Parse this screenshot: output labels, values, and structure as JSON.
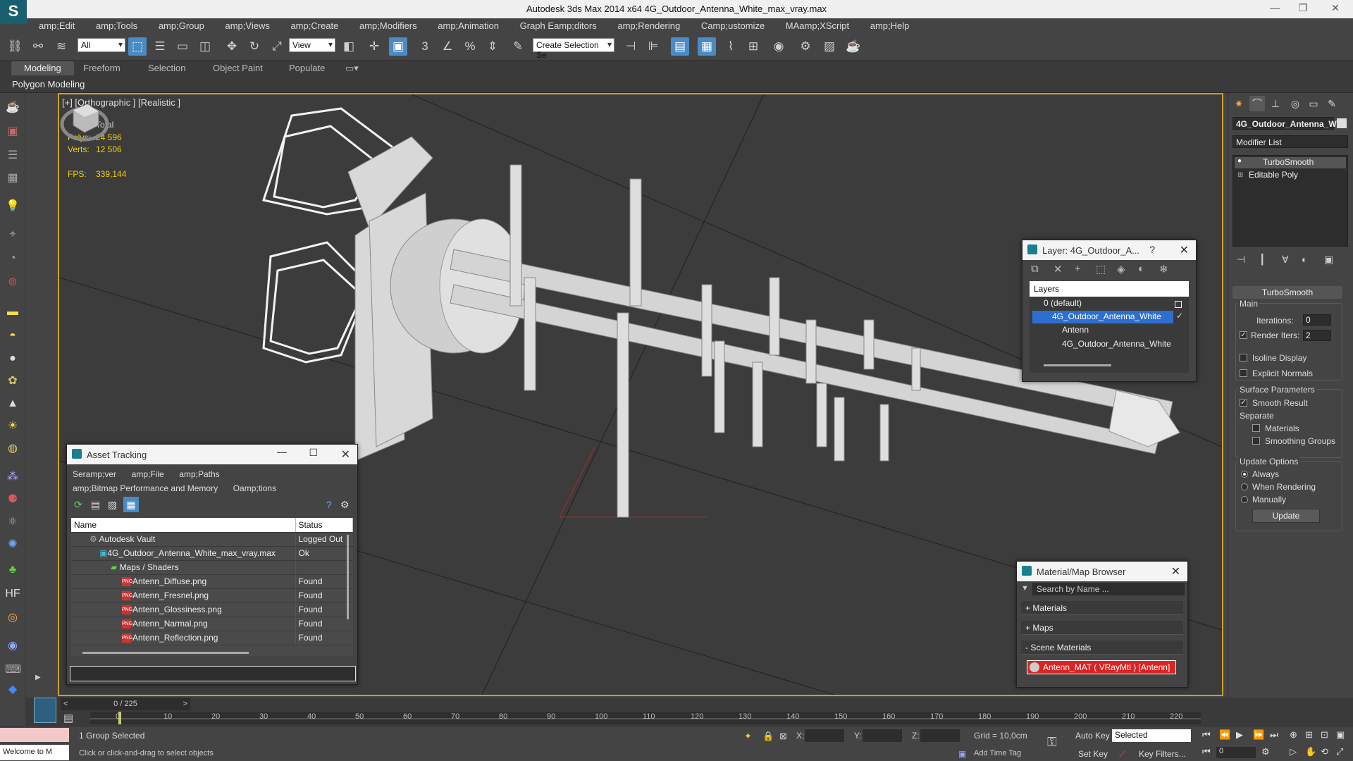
{
  "window": {
    "title": "Autodesk 3ds Max  2014 x64     4G_Outdoor_Antenna_White_max_vray.max"
  },
  "menu": [
    "amp;Edit",
    "amp;Tools",
    "amp;Group",
    "amp;Views",
    "amp;Create",
    "amp;Modifiers",
    "amp;Animation",
    "Graph Eamp;ditors",
    "amp;Rendering",
    "Camp;ustomize",
    "MAamp;XScript",
    "amp;Help"
  ],
  "toolbar": {
    "filter": "All",
    "refcoord": "View",
    "selset": "Create Selection Se"
  },
  "ribbon": {
    "tabs": [
      "Modeling",
      "Freeform",
      "Selection",
      "Object Paint",
      "Populate"
    ],
    "sub": "Polygon Modeling"
  },
  "viewport": {
    "label": "[+] [Orthographic ] [Realistic ]",
    "stats": {
      "total": "Total",
      "polys_label": "Polys:",
      "polys": "24 596",
      "verts_label": "Verts:",
      "verts": "12 506",
      "fps_label": "FPS:",
      "fps": "339,144"
    }
  },
  "layer_dialog": {
    "title": "Layer: 4G_Outdoor_A...",
    "help": "?",
    "header": "Layers",
    "items": [
      {
        "label": "0 (default)"
      },
      {
        "label": "4G_Outdoor_Antenna_White"
      },
      {
        "label": "Antenn"
      },
      {
        "label": "4G_Outdoor_Antenna_White"
      }
    ]
  },
  "asset_tracking": {
    "title": "Asset Tracking",
    "menu1": [
      "Seramp;ver",
      "amp;File",
      "amp;Paths"
    ],
    "menu2": [
      "amp;Bitmap Performance and Memory",
      "Oamp;tions"
    ],
    "col_name": "Name",
    "col_status": "Status",
    "rows": [
      {
        "name": "Autodesk Vault",
        "status": "Logged Out"
      },
      {
        "name": "4G_Outdoor_Antenna_White_max_vray.max",
        "status": "Ok"
      },
      {
        "name": "Maps / Shaders",
        "status": ""
      },
      {
        "name": "Antenn_Diffuse.png",
        "status": "Found"
      },
      {
        "name": "Antenn_Fresnel.png",
        "status": "Found"
      },
      {
        "name": "Antenn_Glossiness.png",
        "status": "Found"
      },
      {
        "name": "Antenn_Narmal.png",
        "status": "Found"
      },
      {
        "name": "Antenn_Reflection.png",
        "status": "Found"
      }
    ]
  },
  "material_browser": {
    "title": "Material/Map Browser",
    "search_placeholder": "Search by Name ...",
    "sections": [
      "+ Materials",
      "+ Maps",
      "- Scene Materials"
    ],
    "scene_material": "Antenn_MAT ( VRayMtl ) [Antenn]"
  },
  "command_panel": {
    "object_name": "4G_Outdoor_Antenna_W",
    "modifier_list": "Modifier List",
    "stack": [
      "TurboSmooth",
      "Editable Poly"
    ],
    "rollout": "TurboSmooth",
    "main": "Main",
    "iterations_label": "Iterations:",
    "iterations": "0",
    "render_iters_label": "Render Iters:",
    "render_iters": "2",
    "isoline": "Isoline Display",
    "explicit_normals": "Explicit Normals",
    "surface_params": "Surface Parameters",
    "smooth_result": "Smooth Result",
    "separate": "Separate",
    "materials": "Materials",
    "smoothing_groups": "Smoothing Groups",
    "update_options": "Update Options",
    "always": "Always",
    "when_rendering": "When Rendering",
    "manually": "Manually",
    "update_btn": "Update"
  },
  "timeline": {
    "frame": "0 / 225",
    "ticks": [
      "0",
      "10",
      "20",
      "30",
      "40",
      "50",
      "60",
      "70",
      "80",
      "90",
      "100",
      "110",
      "120",
      "130",
      "140",
      "150",
      "160",
      "170",
      "180",
      "190",
      "200",
      "210",
      "220"
    ]
  },
  "status": {
    "selected": "1 Group Selected",
    "prompt": "Click or click-and-drag to select objects",
    "maxscript": "Welcome to M",
    "x_label": "X:",
    "y_label": "Y:",
    "z_label": "Z:",
    "grid": "Grid = 10,0cm",
    "add_time_tag": "Add Time Tag",
    "auto_key": "Auto Key",
    "set_key": "Set Key",
    "key_mode": "Selected",
    "key_filters": "Key Filters...",
    "frame_field": "0"
  }
}
